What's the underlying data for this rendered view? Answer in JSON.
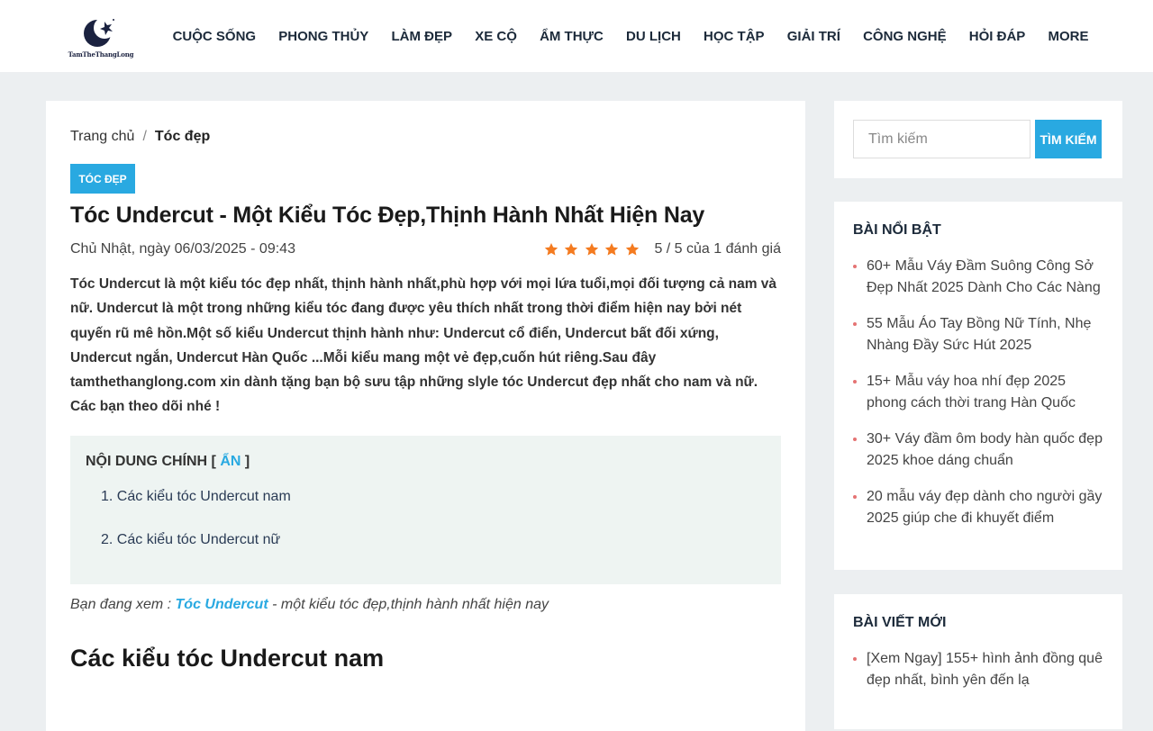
{
  "header": {
    "logo_text": "TamTheThangLong",
    "nav": [
      "CUỘC SỐNG",
      "PHONG THỦY",
      "LÀM ĐẸP",
      "XE CỘ",
      "ẨM THỰC",
      "DU LỊCH",
      "HỌC TẬP",
      "GIẢI TRÍ",
      "CÔNG NGHỆ",
      "HỎI ĐÁP",
      "MORE"
    ]
  },
  "breadcrumb": {
    "home": "Trang chủ",
    "separator": "/",
    "current": "Tóc đẹp"
  },
  "article": {
    "category": "TÓC ĐẸP",
    "title": "Tóc Undercut - Một Kiểu Tóc Đẹp,Thịnh Hành Nhất Hiện Nay",
    "date": "Chủ Nhật, ngày 06/03/2025 - 09:43",
    "rating": {
      "stars": 5,
      "text": "5 / 5 của 1 đánh giá",
      "star_color": "#f47b20"
    },
    "intro": "Tóc Undercut là một kiểu tóc đẹp nhất, thịnh hành nhất,phù hợp với mọi lứa tuổi,mọi đối tượng cả nam và nữ. Undercut là một trong những kiểu tóc đang được yêu thích nhất trong thời điểm hiện nay bởi nét quyến rũ mê hồn.Một số kiểu Undercut thịnh hành như: Undercut cổ điển, Undercut bất đối xứng, Undercut ngắn, Undercut Hàn Quốc ...Mỗi kiểu mang một vẻ đẹp,cuốn hút riêng.Sau đây tamthethanglong.com xin dành tặng bạn bộ sưu tập những slyle tóc Undercut đẹp nhất cho nam và nữ. Các bạn theo dõi nhé !",
    "toc": {
      "heading": "NỘI DUNG CHÍNH [",
      "toggle": "ẨN",
      "heading_end": "]",
      "items": [
        "1. Các kiểu tóc Undercut nam",
        "2. Các kiểu tóc Undercut nữ"
      ]
    },
    "viewing": {
      "prefix": "Bạn đang xem :",
      "link": "Tóc Undercut",
      "suffix": "- một kiểu tóc đẹp,thịnh hành nhất hiện nay"
    },
    "section_heading": "Các kiểu tóc Undercut nam"
  },
  "sidebar": {
    "search": {
      "placeholder": "Tìm kiếm",
      "button": "TÌM KIẾM"
    },
    "featured": {
      "title": "BÀI NỔI BẬT",
      "items": [
        "60+ Mẫu Váy Đầm Suông Công Sở Đẹp Nhất 2025 Dành Cho Các Nàng",
        "55 Mẫu Áo Tay Bồng Nữ Tính, Nhẹ Nhàng Đầy Sức Hút 2025",
        "15+ Mẫu váy hoa nhí đẹp 2025 phong cách thời trang Hàn Quốc",
        "30+ Váy đầm ôm body hàn quốc đẹp 2025 khoe dáng chuẩn",
        "20 mẫu váy đẹp dành cho người gầy 2025 giúp che đi khuyết điểm"
      ]
    },
    "newest": {
      "title": "BÀI VIẾT MỚI",
      "items": [
        "[Xem Ngay] 155+ hình ảnh đồng quê đẹp nhất, bình yên đến lạ"
      ]
    }
  }
}
